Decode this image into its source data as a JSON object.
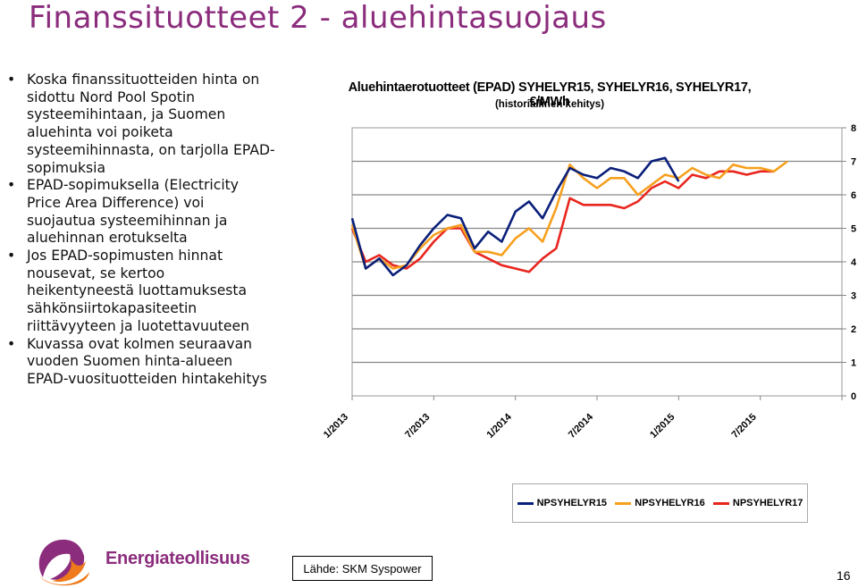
{
  "slide": {
    "title": "Finanssituotteet 2 - aluehintasuojaus",
    "bullets": [
      "Koska finanssituotteiden hinta on sidottu Nord Pool Spotin systeemihintaan, ja Suomen aluehinta voi poiketa systeemihinnasta, on tarjolla EPAD-sopimuksia",
      "EPAD-sopimuksella (Electricity Price Area Difference) voi suojautua systeemihinnan ja aluehinnan erotukselta",
      "Jos EPAD-sopimusten hinnat nousevat, se kertoo heikentyneestä luottamuksesta sähkönsiirtokapasiteetin riittävyyteen ja luotettavuuteen",
      "Kuvassa ovat kolmen seuraavan vuoden Suomen hinta-alueen EPAD-vuosituotteiden hintakehitys"
    ],
    "logo_text": "Energiateollisuus",
    "source": "Lähde: SKM Syspower",
    "page_number": "16"
  },
  "chart_data": {
    "type": "line",
    "title": "Aluehintaerotuotteet (EPAD) SYHELYR15, SYHELYR16, SYHELYR17, €/MWh",
    "subtitle": "(historiallinen kehitys)",
    "xlabel": "",
    "ylabel": "",
    "ylim": [
      0,
      8
    ],
    "y_ticks": [
      "0",
      "1",
      "2",
      "3",
      "4",
      "5",
      "6",
      "7",
      "8"
    ],
    "y_axis_side": "right",
    "x_ticks": [
      "1/2013",
      "7/2013",
      "1/2014",
      "7/2014",
      "1/2015",
      "7/2015"
    ],
    "xlim": [
      "2013-01",
      "2016-01"
    ],
    "grid": true,
    "legend_position": "bottom",
    "x": [
      "2013-01",
      "2013-02",
      "2013-03",
      "2013-04",
      "2013-05",
      "2013-06",
      "2013-07",
      "2013-08",
      "2013-09",
      "2013-10",
      "2013-11",
      "2013-12",
      "2014-01",
      "2014-02",
      "2014-03",
      "2014-04",
      "2014-05",
      "2014-06",
      "2014-07",
      "2014-08",
      "2014-09",
      "2014-10",
      "2014-11",
      "2014-12",
      "2015-01",
      "2015-02",
      "2015-03",
      "2015-04",
      "2015-05",
      "2015-06",
      "2015-07",
      "2015-08",
      "2015-09"
    ],
    "series": [
      {
        "name": "NPSYHELYR15",
        "color": "#0a1f7a",
        "values": [
          5.3,
          3.8,
          4.1,
          3.6,
          3.9,
          4.5,
          5.0,
          5.4,
          5.3,
          4.4,
          4.9,
          4.6,
          5.5,
          5.8,
          5.3,
          6.1,
          6.8,
          6.6,
          6.5,
          6.8,
          6.7,
          6.5,
          7.0,
          7.1,
          6.4,
          null,
          null,
          null,
          null,
          null,
          null,
          null,
          null
        ]
      },
      {
        "name": "NPSYHELYR16",
        "color": "#f7a01e",
        "values": [
          5.1,
          3.8,
          4.1,
          3.8,
          3.9,
          4.4,
          4.8,
          5.0,
          5.1,
          4.3,
          4.3,
          4.2,
          4.7,
          5.0,
          4.6,
          5.6,
          6.9,
          6.5,
          6.2,
          6.5,
          6.5,
          6.0,
          6.3,
          6.6,
          6.5,
          6.8,
          6.6,
          6.5,
          6.9,
          6.8,
          6.8,
          6.7,
          7.0
        ]
      },
      {
        "name": "NPSYHELYR17",
        "color": "#e8261e",
        "values": [
          5.0,
          4.0,
          4.2,
          3.9,
          3.8,
          4.1,
          4.6,
          5.0,
          5.0,
          4.3,
          4.1,
          3.9,
          3.8,
          3.7,
          4.1,
          4.4,
          5.9,
          5.7,
          5.7,
          5.7,
          5.6,
          5.8,
          6.2,
          6.4,
          6.2,
          6.6,
          6.5,
          6.7,
          6.7,
          6.6,
          6.7,
          6.7,
          null
        ]
      }
    ]
  }
}
